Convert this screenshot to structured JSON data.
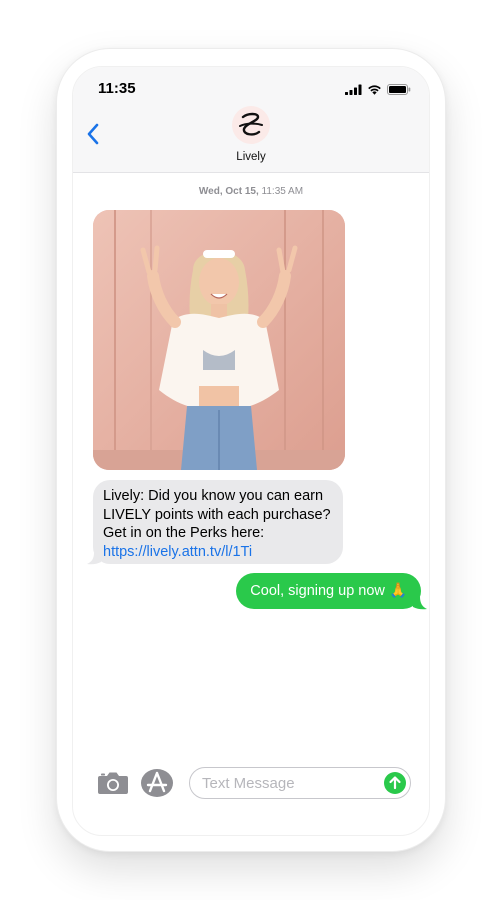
{
  "status_bar": {
    "time": "11:35"
  },
  "header": {
    "contact_name": "Lively",
    "back_icon": "chevron-left-icon",
    "avatar_icon": "lively-logo-icon"
  },
  "conversation": {
    "timestamp_day": "Wed, Oct 15,",
    "timestamp_time": "11:35 AM",
    "incoming_message": {
      "line1": "Lively: Did you know you can earn",
      "line2": "LIVELY points with each purchase?",
      "line3": "Get in on the Perks here:",
      "link": "https://lively.attn.tv/l/1Ti"
    },
    "outgoing_message": {
      "text": "Cool, signing up now",
      "emoji": "🙏"
    }
  },
  "compose": {
    "placeholder": "Text Message",
    "camera_icon": "camera-icon",
    "appstore_icon": "app-store-icon",
    "send_icon": "send-arrow-icon"
  },
  "colors": {
    "imessage_blue": "#1a73e8",
    "sms_green": "#2ac94b",
    "incoming_bubble": "#e9e9eb",
    "header_bg": "#f7f7f8"
  }
}
